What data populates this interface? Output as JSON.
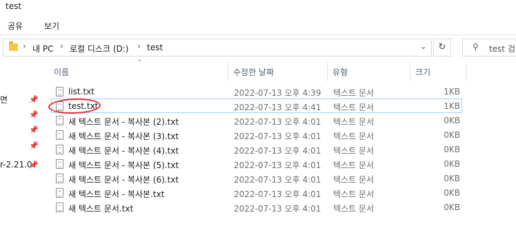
{
  "window": {
    "title": "test"
  },
  "ribbon": {
    "tabs": [
      "공유",
      "보기"
    ]
  },
  "address": {
    "crumbs": [
      "내 PC",
      "로컬 디스크 (D:)",
      "test"
    ],
    "separator": "›"
  },
  "search": {
    "placeholder": "test 검색"
  },
  "nav": {
    "items": [
      {
        "label": "면",
        "pinned": true
      },
      {
        "label": "",
        "pinned": true
      },
      {
        "label": "",
        "pinned": true
      },
      {
        "label": "",
        "pinned": true
      },
      {
        "label": "r-2.21.0",
        "pinned": true
      }
    ]
  },
  "columns": {
    "name": "이름",
    "date": "수정한 날짜",
    "type": "유형",
    "size": "크기"
  },
  "files": [
    {
      "name": "list.txt",
      "date": "2022-07-13 오후 4:39",
      "type": "텍스트 문서",
      "size": "1KB",
      "selected": false
    },
    {
      "name": "test.txt",
      "date": "2022-07-13 오후 4:41",
      "type": "텍스트 문서",
      "size": "1KB",
      "selected": true
    },
    {
      "name": "새 텍스트 문서 - 복사본 (2).txt",
      "date": "2022-07-13 오후 4:01",
      "type": "텍스트 문서",
      "size": "0KB",
      "selected": false
    },
    {
      "name": "새 텍스트 문서 - 복사본 (3).txt",
      "date": "2022-07-13 오후 4:01",
      "type": "텍스트 문서",
      "size": "0KB",
      "selected": false
    },
    {
      "name": "새 텍스트 문서 - 복사본 (4).txt",
      "date": "2022-07-13 오후 4:01",
      "type": "텍스트 문서",
      "size": "0KB",
      "selected": false
    },
    {
      "name": "새 텍스트 문서 - 복사본 (5).txt",
      "date": "2022-07-13 오후 4:01",
      "type": "텍스트 문서",
      "size": "0KB",
      "selected": false
    },
    {
      "name": "새 텍스트 문서 - 복사본 (6).txt",
      "date": "2022-07-13 오후 4:01",
      "type": "텍스트 문서",
      "size": "0KB",
      "selected": false
    },
    {
      "name": "새 텍스트 문서 - 복사본.txt",
      "date": "2022-07-13 오후 4:01",
      "type": "텍스트 문서",
      "size": "0KB",
      "selected": false
    },
    {
      "name": "새 텍스트 문서.txt",
      "date": "2022-07-13 오후 4:01",
      "type": "텍스트 문서",
      "size": "0KB",
      "selected": false
    }
  ],
  "colors": {
    "selection_border": "#99d1ff",
    "annotation": "#e8262d",
    "folder": "#f3c94e"
  }
}
